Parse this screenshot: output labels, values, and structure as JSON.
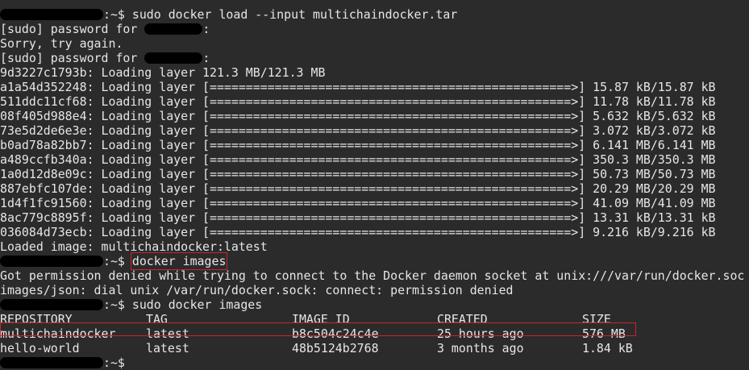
{
  "terminal": {
    "lines": [
      {
        "type": "cmd",
        "prompt": ":~$",
        "command": " sudo docker load --input multichaindocker.tar"
      },
      {
        "type": "sudo",
        "text": "[sudo] password for ",
        "suffix": ":"
      },
      {
        "type": "text",
        "text": "Sorry, try again."
      },
      {
        "type": "sudo",
        "text": "[sudo] password for ",
        "suffix": ":"
      },
      {
        "type": "text",
        "text": "9d3227c1793b: Loading layer 121.3 MB/121.3 MB"
      },
      {
        "type": "text",
        "text": "a1a54d352248: Loading layer [==================================================>] 15.87 kB/15.87 kB"
      },
      {
        "type": "text",
        "text": "511ddc11cf68: Loading layer [==================================================>] 11.78 kB/11.78 kB"
      },
      {
        "type": "text",
        "text": "08f405d988e4: Loading layer [==================================================>] 5.632 kB/5.632 kB"
      },
      {
        "type": "text",
        "text": "73e5d2de6e3e: Loading layer [==================================================>] 3.072 kB/3.072 kB"
      },
      {
        "type": "text",
        "text": "b0ad78a82bb7: Loading layer [==================================================>] 6.141 MB/6.141 MB"
      },
      {
        "type": "text",
        "text": "a489ccfb340a: Loading layer [==================================================>] 350.3 MB/350.3 MB"
      },
      {
        "type": "text",
        "text": "1a0d12d8e09c: Loading layer [==================================================>] 50.73 MB/50.73 MB"
      },
      {
        "type": "text",
        "text": "887ebfc107de: Loading layer [==================================================>] 20.29 MB/20.29 MB"
      },
      {
        "type": "text",
        "text": "1d4f1fc91560: Loading layer [==================================================>] 41.09 MB/41.09 MB"
      },
      {
        "type": "text",
        "text": "8ac779c8895f: Loading layer [==================================================>] 13.31 kB/13.31 kB"
      },
      {
        "type": "text",
        "text": "036084d73ecb: Loading layer [==================================================>] 9.216 kB/9.216 kB"
      },
      {
        "type": "text",
        "text": "Loaded image: multichaindocker:latest"
      },
      {
        "type": "cmd",
        "prompt": ":~$",
        "command": "docker images",
        "highlight": true
      },
      {
        "type": "text",
        "text": "Got permission denied while trying to connect to the Docker daemon socket at unix:///var/run/docker.soc"
      },
      {
        "type": "text",
        "text": "images/json: dial unix /var/run/docker.sock: connect: permission denied"
      },
      {
        "type": "cmd",
        "prompt": ":~$",
        "command": " sudo docker images"
      }
    ],
    "table": {
      "headers": [
        "REPOSITORY",
        "TAG",
        "IMAGE ID",
        "CREATED",
        "SIZE"
      ],
      "rows": [
        {
          "cells": [
            "multichaindocker",
            "latest",
            "b8c504c24c4e",
            "25 hours ago",
            "576 MB"
          ],
          "highlight": true
        },
        {
          "cells": [
            "hello-world",
            "latest",
            "48b5124b2768",
            "3 months ago",
            "1.84 kB"
          ]
        }
      ]
    },
    "last_prompt": ":~$"
  },
  "colors": {
    "background": "#2b2b2b",
    "text": "#e6e6e6",
    "redaction": "#000000",
    "highlight_border": "#c8262a"
  }
}
